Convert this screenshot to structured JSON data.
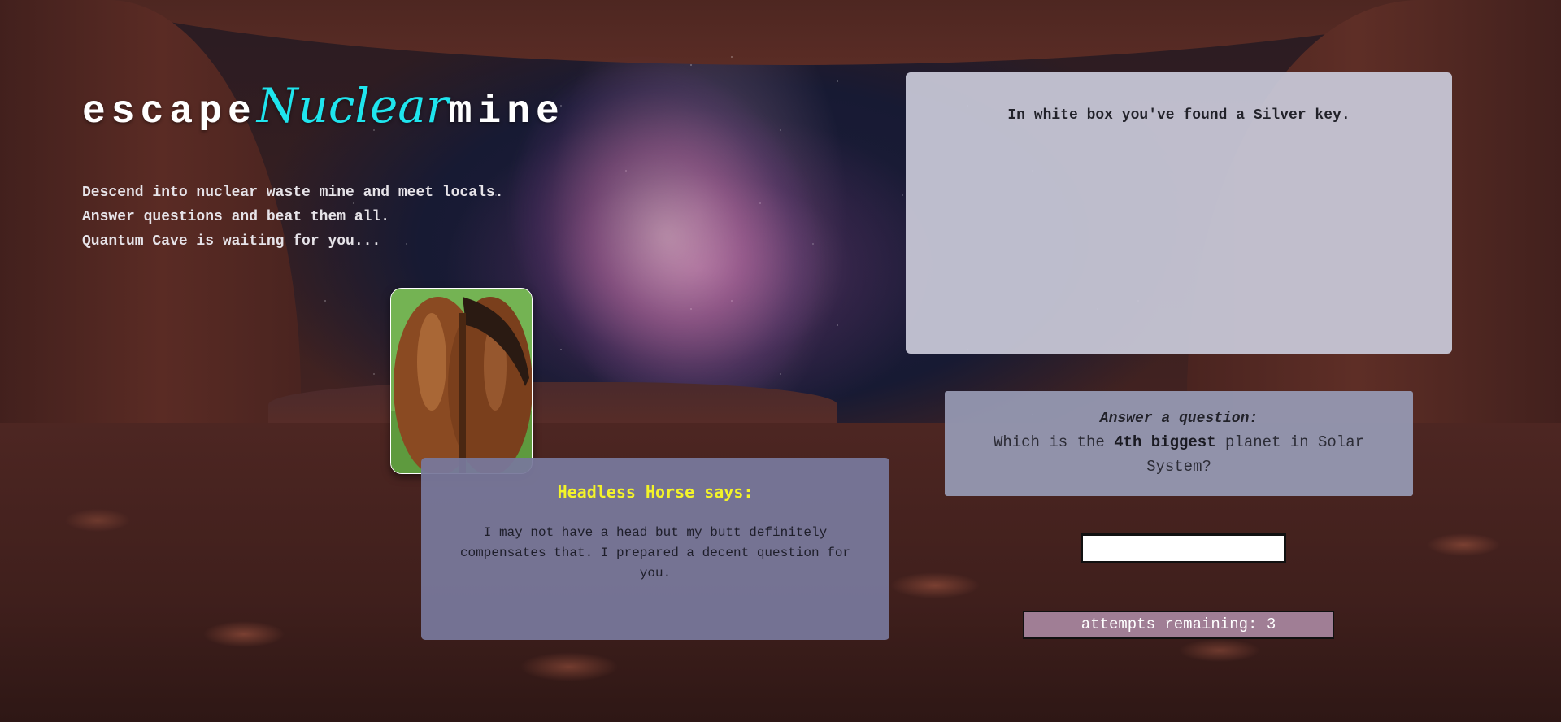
{
  "header": {
    "title_part1": "escape",
    "title_part2": "Nuclear",
    "title_part3": "mine"
  },
  "intro": {
    "lines": [
      "Descend into nuclear waste mine and meet locals.",
      "Answer questions and beat them all.",
      "Quantum Cave is waiting for you..."
    ]
  },
  "character": {
    "avatar_icon": "horse-rear-image",
    "speaker_heading": "Headless Horse says:",
    "speech": "I may not have a head but my butt definitely compensates that. I prepared a decent question for you."
  },
  "message": {
    "text": "In white box you've found a Silver key."
  },
  "question": {
    "heading": "Answer a question:",
    "text_before": "Which is the ",
    "text_bold": "4th biggest",
    "text_after": " planet in Solar System?"
  },
  "answer": {
    "value": "",
    "placeholder": ""
  },
  "attempts": {
    "label": "attempts remaining: ",
    "count": "3"
  },
  "colors": {
    "title": "#ffffff",
    "title_accent": "#1fe5ee",
    "speaker_heading": "#f3f329",
    "attempts_bg": "#a07e95"
  }
}
